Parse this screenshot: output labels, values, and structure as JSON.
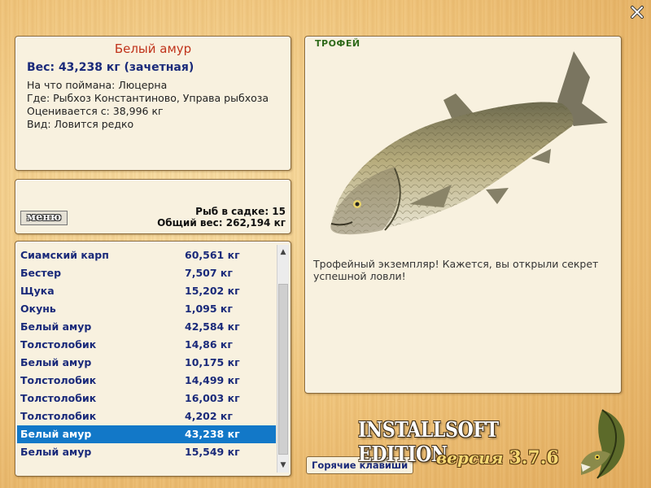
{
  "fish_info": {
    "name": "Белый амур",
    "weight_line": "Вес: 43,238 кг (зачетная)",
    "bait_line": "На что поймана: Люцерна",
    "location_line": "Где: Рыбхоз Константиново, Управа рыбхоза",
    "value_line": "Оценивается с: 38,996 кг",
    "kind_line": "Вид: Ловится редко"
  },
  "keepnet": {
    "menu_label": "меню",
    "count_line": "Рыб в садке: 15",
    "total_line": "Общий вес: 262,194 кг"
  },
  "catch_list": [
    {
      "name": "Сиамский карп",
      "weight": "60,561 кг"
    },
    {
      "name": "Бестер",
      "weight": "7,507 кг"
    },
    {
      "name": "Щука",
      "weight": "15,202 кг"
    },
    {
      "name": "Окунь",
      "weight": "1,095 кг"
    },
    {
      "name": "Белый амур",
      "weight": "42,584 кг"
    },
    {
      "name": "Толстолобик",
      "weight": "14,86 кг"
    },
    {
      "name": "Белый амур",
      "weight": "10,175 кг"
    },
    {
      "name": "Толстолобик",
      "weight": "14,499 кг"
    },
    {
      "name": "Толстолобик",
      "weight": "16,003 кг"
    },
    {
      "name": "Толстолобик",
      "weight": "4,202 кг"
    },
    {
      "name": "Белый амур",
      "weight": "43,238 кг",
      "selected": true
    },
    {
      "name": "Белый амур",
      "weight": "15,549 кг"
    }
  ],
  "trophy": {
    "label": "ТРОФЕЙ",
    "description": "Трофейный экземпляр! Кажется, вы открыли секрет успешной ловли!"
  },
  "hotkeys_label": "Горячие клавиши",
  "brand": {
    "title": "INSTALLSOFT EDITION",
    "version_prefix": "версия",
    "version_number": "3.7.6"
  },
  "colors": {
    "selected_row": "#1278c8",
    "fish_name": "#c0331b",
    "list_text": "#1a2a7a",
    "trophy_label": "#2e6a1a"
  }
}
